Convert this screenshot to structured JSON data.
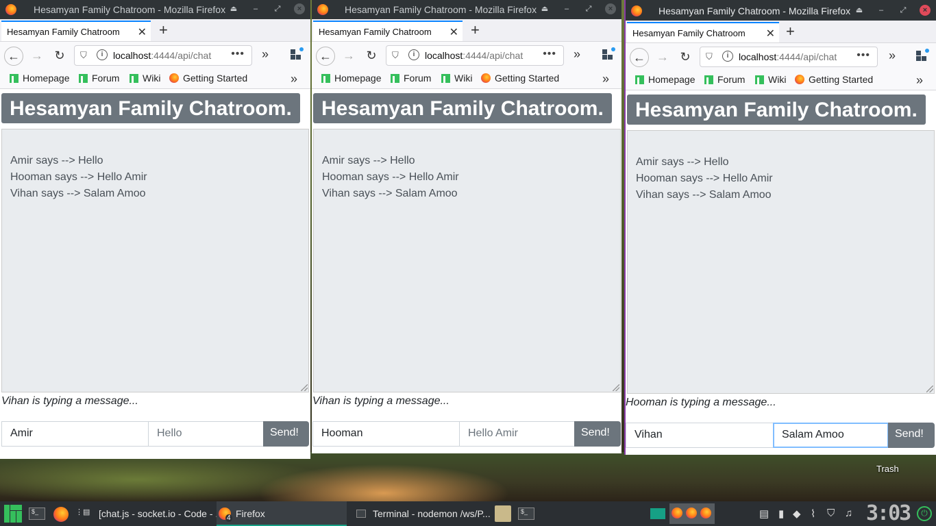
{
  "windows": [
    {
      "window_title": "Hesamyan Family Chatroom - Mozilla Firefox",
      "tab_title": "Hesamyan Family Chatroom",
      "url_host": "localhost",
      "url_rest": ":4444/api/chat",
      "bookmarks": [
        "Homepage",
        "Forum",
        "Wiki",
        "Getting Started"
      ],
      "heading": "Hesamyan Family Chatroom.",
      "messages": [
        "Amir says --> Hello",
        "Hooman says --> Hello Amir",
        "Vihan says --> Salam Amoo"
      ],
      "typing_status": "Vihan is typing a message...",
      "name_value": "Amir",
      "message_value": "Hello",
      "send_label": "Send!"
    },
    {
      "window_title": "Hesamyan Family Chatroom - Mozilla Firefox",
      "tab_title": "Hesamyan Family Chatroom",
      "url_host": "localhost",
      "url_rest": ":4444/api/chat",
      "bookmarks": [
        "Homepage",
        "Forum",
        "Wiki",
        "Getting Started"
      ],
      "heading": "Hesamyan Family Chatroom.",
      "messages": [
        "Amir says --> Hello",
        "Hooman says --> Hello Amir",
        "Vihan says --> Salam Amoo"
      ],
      "typing_status": "Vihan is typing a message...",
      "name_value": "Hooman",
      "message_value": "Hello Amir",
      "send_label": "Send!"
    },
    {
      "window_title": "Hesamyan Family Chatroom - Mozilla Firefox",
      "tab_title": "Hesamyan Family Chatroom",
      "url_host": "localhost",
      "url_rest": ":4444/api/chat",
      "bookmarks": [
        "Homepage",
        "Forum",
        "Wiki",
        "Getting Started"
      ],
      "heading": "Hesamyan Family Chatroom.",
      "messages": [
        "Amir says --> Hello",
        "Hooman says --> Hello Amir",
        "Vihan says --> Salam Amoo"
      ],
      "typing_status": "Hooman is typing a message...",
      "name_value": "Vihan",
      "message_value": "Salam Amoo",
      "send_label": "Send!"
    }
  ],
  "desktop": {
    "trash_label": "Trash"
  },
  "taskbar": {
    "items": [
      {
        "label": "[chat.js - socket.io - Code - ..."
      },
      {
        "label": "Firefox",
        "badge": "4"
      },
      {
        "label": "Terminal - nodemon /ws/P..."
      }
    ],
    "clock": "3:03"
  },
  "colors": {
    "accent": "#0a84ff",
    "heading_bg": "#6c757d",
    "chat_bg": "#e9ecef",
    "manjaro_green": "#35bf5c"
  }
}
